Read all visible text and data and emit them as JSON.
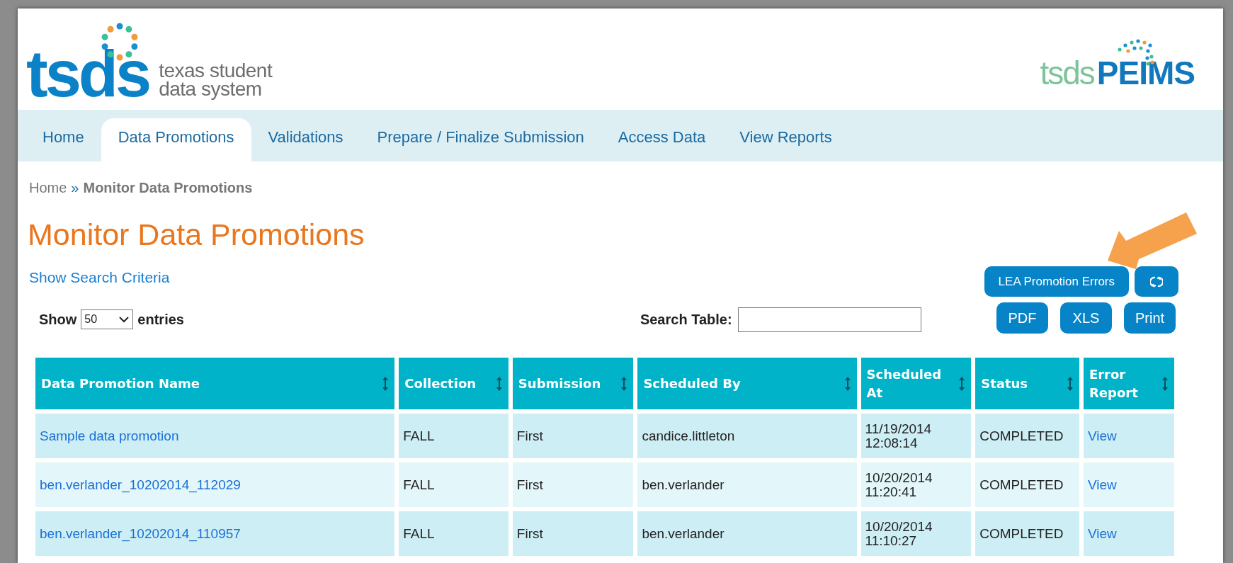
{
  "header": {
    "logo": {
      "mark": "tsds",
      "tagline": [
        "texas student",
        "data system"
      ]
    },
    "product_logo": {
      "prefix": "tsds",
      "name": "PEIMS"
    }
  },
  "nav": [
    {
      "label": "Home",
      "selected": false
    },
    {
      "label": "Data Promotions",
      "selected": true
    },
    {
      "label": "Validations",
      "selected": false
    },
    {
      "label": "Prepare / Finalize Submission",
      "selected": false
    },
    {
      "label": "Access Data",
      "selected": false
    },
    {
      "label": "View Reports",
      "selected": false
    }
  ],
  "breadcrumb": {
    "home": "Home",
    "separator": "»",
    "current": "Monitor Data Promotions"
  },
  "title": "Monitor Data Promotions",
  "search_criteria_link": "Show Search Criteria",
  "buttons": [
    {
      "label": "LEA Promotion Errors",
      "kind": "text"
    },
    {
      "kind": "refresh"
    }
  ],
  "export_buttons": [
    "PDF",
    "XLS",
    "Print"
  ],
  "page_length": {
    "before": "Show",
    "value": "50",
    "after": "entries"
  },
  "search": {
    "label": "Search Table:"
  },
  "table": {
    "columns": [
      "Data Promotion Name",
      "Collection",
      "Submission",
      "Scheduled By",
      "Scheduled At",
      "Status",
      "Error Report"
    ],
    "rows": [
      [
        "Sample data promotion",
        "FALL",
        "First",
        "candice.littleton",
        "11/19/2014 12:08:14",
        "COMPLETED",
        "View"
      ],
      [
        "ben.verlander_10202014_112029",
        "FALL",
        "First",
        "ben.verlander",
        "10/20/2014 11:20:41",
        "COMPLETED",
        "View"
      ],
      [
        "ben.verlander_10202014_110957",
        "FALL",
        "First",
        "ben.verlander",
        "10/20/2014 11:10:27",
        "COMPLETED",
        "View"
      ]
    ]
  }
}
